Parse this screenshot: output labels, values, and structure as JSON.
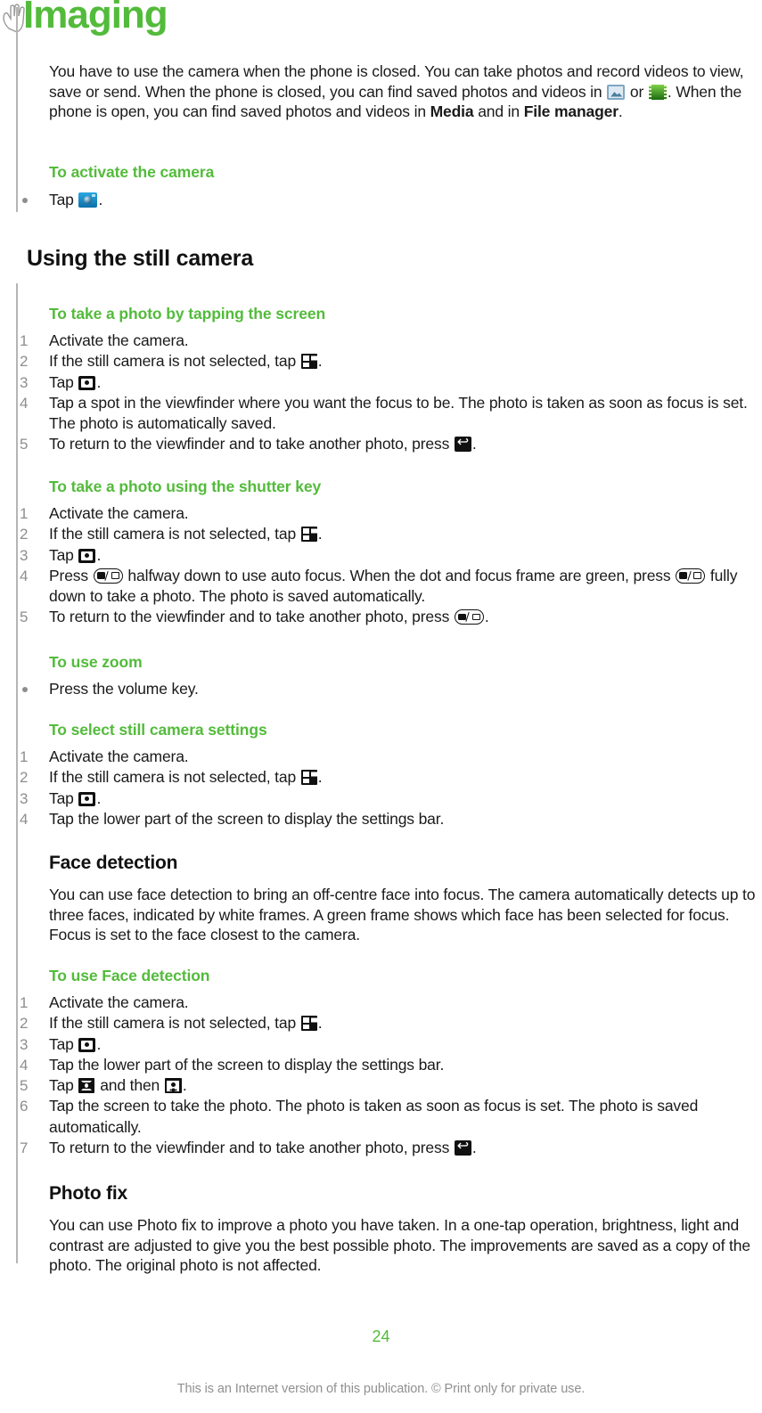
{
  "chapter": {
    "title": "Imaging"
  },
  "intro": {
    "part1": "You have to use the camera when the phone is closed. You can take photos and record videos to view, save or send. When the phone is closed, you can find saved photos and videos in ",
    "or": " or ",
    "part2": ". When the phone is open, you can find saved photos and videos in ",
    "bold1": "Media",
    "and": " and in ",
    "bold2": "File manager",
    "end": "."
  },
  "activate": {
    "title": "To activate the camera",
    "step": "Tap ",
    "end": "."
  },
  "still_camera": {
    "title": "Using the still camera"
  },
  "tap_screen": {
    "title": "To take a photo by tapping the screen",
    "s1": "Activate the camera.",
    "s2a": "If the still camera is not selected, tap ",
    "s2b": ".",
    "s3a": "Tap ",
    "s3b": ".",
    "s4": "Tap a spot in the viewfinder where you want the focus to be. The photo is taken as soon as focus is set. The photo is automatically saved.",
    "s5a": "To return to the viewfinder and to take another photo, press ",
    "s5b": "."
  },
  "shutter_key": {
    "title": "To take a photo using the shutter key",
    "s1": "Activate the camera.",
    "s2a": "If the still camera is not selected, tap ",
    "s2b": ".",
    "s3a": "Tap ",
    "s3b": ".",
    "s4a": "Press ",
    "s4b": " halfway down to use auto focus. When the dot and focus frame are green, press ",
    "s4c": " fully down to take a photo. The photo is saved automatically.",
    "s5a": "To return to the viewfinder and to take another photo, press ",
    "s5b": "."
  },
  "zoom": {
    "title": "To use zoom",
    "step": "Press the volume key."
  },
  "settings": {
    "title": "To select still camera settings",
    "s1": "Activate the camera.",
    "s2a": "If the still camera is not selected, tap ",
    "s2b": ".",
    "s3a": "Tap ",
    "s3b": ".",
    "s4": "Tap the lower part of the screen to display the settings bar."
  },
  "face_detection": {
    "title": "Face detection",
    "body": "You can use face detection to bring an off-centre face into focus. The camera automatically detects up to three faces, indicated by white frames. A green frame shows which face has been selected for focus. Focus is set to the face closest to the camera."
  },
  "use_face": {
    "title": "To use Face detection",
    "s1": "Activate the camera.",
    "s2a": "If the still camera is not selected, tap ",
    "s2b": ".",
    "s3a": "Tap ",
    "s3b": ".",
    "s4": "Tap the lower part of the screen to display the settings bar.",
    "s5a": "Tap ",
    "s5b": " and then ",
    "s5c": ".",
    "s6": "Tap the screen to take the photo. The photo is taken as soon as focus is set. The photo is saved automatically.",
    "s7a": "To return to the viewfinder and to take another photo, press ",
    "s7b": "."
  },
  "photo_fix": {
    "title": "Photo fix",
    "body": "You can use Photo fix to improve a photo you have taken. In a one-tap operation, brightness, light and contrast are adjusted to give you the best possible photo. The improvements are saved as a copy of the photo. The original photo is not affected."
  },
  "footer": {
    "page_number": "24",
    "note": "This is an Internet version of this publication. © Print only for private use."
  },
  "colors": {
    "accent_green": "#53bb3b",
    "rule_grey": "#b5b5b5",
    "marker_grey": "#8e8e8e"
  }
}
